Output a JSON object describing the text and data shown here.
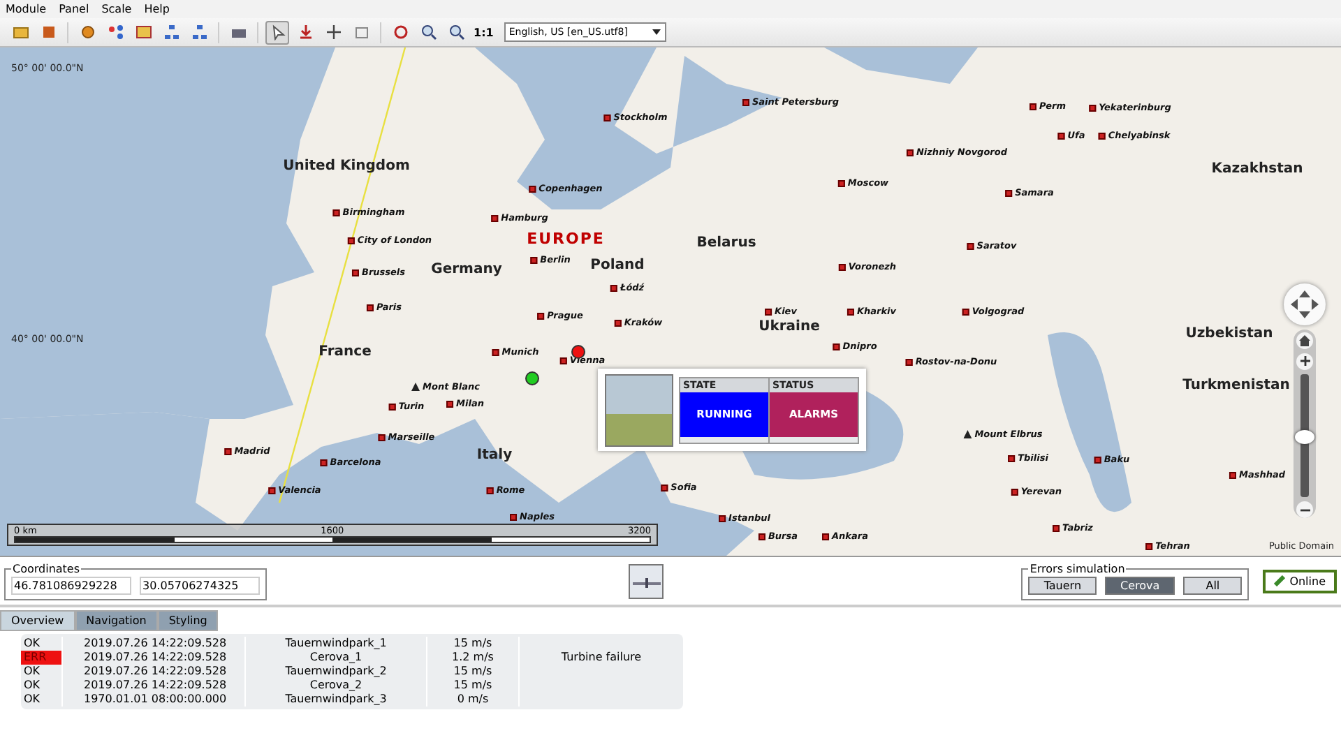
{
  "menu": [
    "Module",
    "Panel",
    "Scale",
    "Help"
  ],
  "toolbar": {
    "tools": [
      {
        "selected": false
      },
      {
        "selected": false
      },
      {
        "selected": false
      },
      {
        "selected": false
      },
      {
        "selected": false
      },
      {
        "selected": false
      },
      {
        "selected": false
      },
      {
        "selected": false
      },
      {
        "selected": true
      },
      {
        "selected": false
      },
      {
        "selected": false
      },
      {
        "selected": false
      },
      {
        "selected": false
      },
      {
        "selected": false
      },
      {
        "selected": false
      }
    ],
    "zoom_reset": "1:1",
    "language": "English, US [en_US.utf8]"
  },
  "map": {
    "latitudes": [
      "50° 00' 00.0\"N",
      "40° 00' 00.0\"N"
    ],
    "labels": [
      {
        "kind": "country",
        "text": "United Kingdom"
      },
      {
        "kind": "country",
        "text": "Germany"
      },
      {
        "kind": "country",
        "text": "Poland"
      },
      {
        "kind": "country",
        "text": "Belarus"
      },
      {
        "kind": "country",
        "text": "France"
      },
      {
        "kind": "country",
        "text": "Ukraine"
      },
      {
        "kind": "country",
        "text": "Italy"
      },
      {
        "kind": "country",
        "text": "Kazakhstan"
      },
      {
        "kind": "country",
        "text": "Uzbekistan"
      },
      {
        "kind": "country",
        "text": "Turkmenistan"
      },
      {
        "kind": "region",
        "text": "EUROPE"
      },
      {
        "kind": "city",
        "text": "Perm"
      },
      {
        "kind": "city",
        "text": "Yekaterinburg"
      },
      {
        "kind": "city",
        "text": "Chelyabinsk"
      },
      {
        "kind": "city",
        "text": "Stockholm"
      },
      {
        "kind": "city",
        "text": "Saint Petersburg"
      },
      {
        "kind": "city",
        "text": "Nizhniy Novgorod"
      },
      {
        "kind": "city",
        "text": "Ufa"
      },
      {
        "kind": "city",
        "text": "Copenhagen"
      },
      {
        "kind": "city",
        "text": "Moscow"
      },
      {
        "kind": "city",
        "text": "Samara"
      },
      {
        "kind": "city",
        "text": "Birmingham"
      },
      {
        "kind": "city",
        "text": "City of London"
      },
      {
        "kind": "city",
        "text": "Hamburg"
      },
      {
        "kind": "city",
        "text": "Berlin"
      },
      {
        "kind": "city",
        "text": "Brussels"
      },
      {
        "kind": "city",
        "text": "Paris"
      },
      {
        "kind": "city",
        "text": "Łódź"
      },
      {
        "kind": "city",
        "text": "Voronezh"
      },
      {
        "kind": "city",
        "text": "Saratov"
      },
      {
        "kind": "city",
        "text": "Prague"
      },
      {
        "kind": "city",
        "text": "Kraków"
      },
      {
        "kind": "city",
        "text": "Kiev"
      },
      {
        "kind": "city",
        "text": "Kharkiv"
      },
      {
        "kind": "city",
        "text": "Volgograd"
      },
      {
        "kind": "city",
        "text": "Munich"
      },
      {
        "kind": "city",
        "text": "Vienna"
      },
      {
        "kind": "city",
        "text": "Dnipro"
      },
      {
        "kind": "city",
        "text": "Rostov-na-Donu"
      },
      {
        "kind": "peak",
        "text": "Mont Blanc"
      },
      {
        "kind": "city",
        "text": "Turin"
      },
      {
        "kind": "city",
        "text": "Milan"
      },
      {
        "kind": "city",
        "text": "Marseille"
      },
      {
        "kind": "peak",
        "text": "Mount Elbrus"
      },
      {
        "kind": "city",
        "text": "Tbilisi"
      },
      {
        "kind": "city",
        "text": "Baku"
      },
      {
        "kind": "city",
        "text": "Madrid"
      },
      {
        "kind": "city",
        "text": "Barcelona"
      },
      {
        "kind": "city",
        "text": "Valencia"
      },
      {
        "kind": "city",
        "text": "Rome"
      },
      {
        "kind": "city",
        "text": "Sofia"
      },
      {
        "kind": "city",
        "text": "Yerevan"
      },
      {
        "kind": "city",
        "text": "Naples"
      },
      {
        "kind": "city",
        "text": "Istanbul"
      },
      {
        "kind": "city",
        "text": "Bursa"
      },
      {
        "kind": "city",
        "text": "Ankara"
      },
      {
        "kind": "city",
        "text": "Tabriz"
      },
      {
        "kind": "city",
        "text": "Tehran"
      },
      {
        "kind": "city",
        "text": "Mashhad"
      }
    ],
    "sites": [
      {
        "color": "#22cc22"
      },
      {
        "color": "#ee1111"
      }
    ],
    "popup": {
      "cells": [
        {
          "header": "STATE",
          "value": "RUNNING",
          "color": "#0000ff"
        },
        {
          "header": "STATUS",
          "value": "ALARMS",
          "color": "#b0215c"
        }
      ]
    },
    "scale": [
      "0 km",
      "1600",
      "3200"
    ],
    "zoom_slider": {
      "level": 0.5
    },
    "credit": "Public Domain"
  },
  "coordinates": {
    "title": "Coordinates",
    "values": [
      "46.781086929228",
      "30.05706274325"
    ]
  },
  "errors_simulation": {
    "title": "Errors simulation",
    "buttons": [
      {
        "label": "Tauern",
        "selected": false
      },
      {
        "label": "Cerova",
        "selected": true
      },
      {
        "label": "All",
        "selected": false
      }
    ]
  },
  "online": "Online",
  "tabs": [
    {
      "label": "Overview",
      "selected": true
    },
    {
      "label": "Navigation",
      "selected": false
    },
    {
      "label": "Styling",
      "selected": false
    }
  ],
  "rows": [
    {
      "status": "OK",
      "error": false,
      "time": "2019.07.26 14:22:09.528",
      "park": "Tauernwindpark_1",
      "speed": "15 m/s"
    },
    {
      "status": "ERR",
      "error": true,
      "time": "2019.07.26 14:22:09.528",
      "park": "Cerova_1",
      "speed": "1.2 m/s",
      "message": "Turbine failure"
    },
    {
      "status": "OK",
      "error": false,
      "time": "2019.07.26 14:22:09.528",
      "park": "Tauernwindpark_2",
      "speed": "15 m/s"
    },
    {
      "status": "OK",
      "error": false,
      "time": "2019.07.26 14:22:09.528",
      "park": "Cerova_2",
      "speed": "15 m/s"
    },
    {
      "status": "OK",
      "error": false,
      "time": "1970.01.01 08:00:00.000",
      "park": "Tauernwindpark_3",
      "speed": "0 m/s"
    }
  ]
}
